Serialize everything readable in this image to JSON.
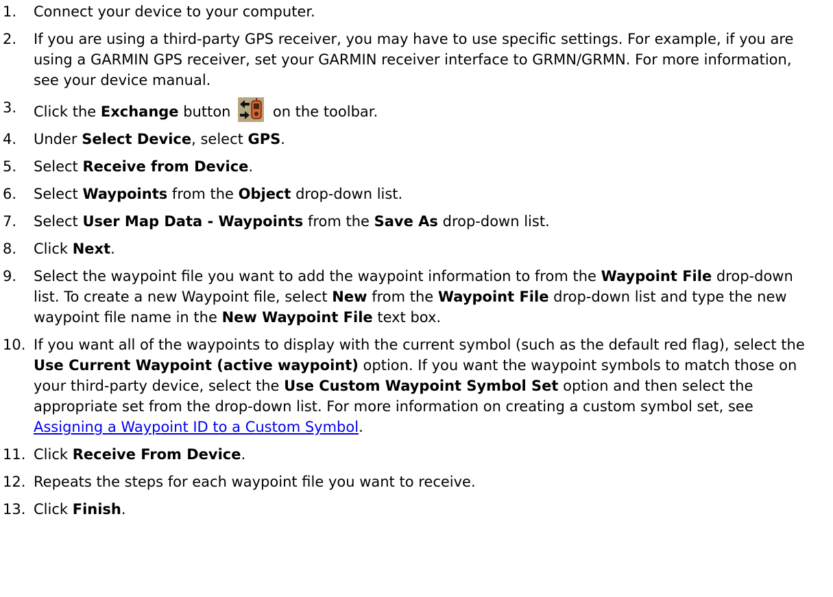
{
  "steps": [
    {
      "num": "1.",
      "parts": [
        {
          "t": "Connect your device to your computer."
        }
      ]
    },
    {
      "num": "2.",
      "parts": [
        {
          "t": "If you are using a third-party GPS receiver, you may have to use specific settings. For example, if you are using a GARMIN GPS receiver, set your GARMIN receiver interface to GRMN/GRMN. For more information, see your device manual."
        }
      ]
    },
    {
      "num": "3.",
      "parts": [
        {
          "t": "Click the "
        },
        {
          "t": "Exchange",
          "b": true
        },
        {
          "t": " button "
        },
        {
          "icon": "exchange-gps-icon"
        },
        {
          "t": " on the toolbar."
        }
      ]
    },
    {
      "num": "4.",
      "parts": [
        {
          "t": "Under "
        },
        {
          "t": "Select Device",
          "b": true
        },
        {
          "t": ", select "
        },
        {
          "t": "GPS",
          "b": true
        },
        {
          "t": "."
        }
      ]
    },
    {
      "num": "5.",
      "parts": [
        {
          "t": "Select "
        },
        {
          "t": "Receive from Device",
          "b": true
        },
        {
          "t": "."
        }
      ]
    },
    {
      "num": "6.",
      "parts": [
        {
          "t": "Select "
        },
        {
          "t": "Waypoints",
          "b": true
        },
        {
          "t": " from the "
        },
        {
          "t": "Object",
          "b": true
        },
        {
          "t": " drop-down list."
        }
      ]
    },
    {
      "num": "7.",
      "parts": [
        {
          "t": "Select "
        },
        {
          "t": "User Map Data - Waypoints",
          "b": true
        },
        {
          "t": " from the "
        },
        {
          "t": "Save As",
          "b": true
        },
        {
          "t": " drop-down list."
        }
      ]
    },
    {
      "num": "8.",
      "parts": [
        {
          "t": "Click "
        },
        {
          "t": "Next",
          "b": true
        },
        {
          "t": "."
        }
      ]
    },
    {
      "num": "9.",
      "parts": [
        {
          "t": "Select the waypoint file you want to add the waypoint information to from the "
        },
        {
          "t": "Waypoint File",
          "b": true
        },
        {
          "t": " drop-down list. To create a new Waypoint file, select "
        },
        {
          "t": "New",
          "b": true
        },
        {
          "t": " from the "
        },
        {
          "t": "Waypoint File",
          "b": true
        },
        {
          "t": " drop-down list and type the new waypoint file name in the "
        },
        {
          "t": "New Waypoint File",
          "b": true
        },
        {
          "t": " text box."
        }
      ]
    },
    {
      "num": "10.",
      "parts": [
        {
          "t": "If you want all of the waypoints to display with the current symbol (such as the default red flag), select the "
        },
        {
          "t": "Use Current Waypoint (active waypoint)",
          "b": true
        },
        {
          "t": " option. If you want the waypoint symbols to match those on your third-party device, select the "
        },
        {
          "t": "Use Custom Waypoint Symbol Set",
          "b": true
        },
        {
          "t": " option and then select the appropriate set from the drop-down list. For more information on creating a custom symbol set, see "
        },
        {
          "t": "Assigning a Waypoint ID to a Custom Symbol",
          "link": true
        },
        {
          "t": "."
        }
      ]
    },
    {
      "num": "11.",
      "parts": [
        {
          "t": "Click "
        },
        {
          "t": "Receive From Device",
          "b": true
        },
        {
          "t": "."
        }
      ]
    },
    {
      "num": "12.",
      "parts": [
        {
          "t": "Repeats the steps for each waypoint file you want to receive."
        }
      ]
    },
    {
      "num": "13.",
      "parts": [
        {
          "t": "Click "
        },
        {
          "t": "Finish",
          "b": true
        },
        {
          "t": "."
        }
      ]
    }
  ],
  "colors": {
    "link": "#0000ee",
    "icon_bg": "#b8a882",
    "icon_device": "#e0602a"
  }
}
